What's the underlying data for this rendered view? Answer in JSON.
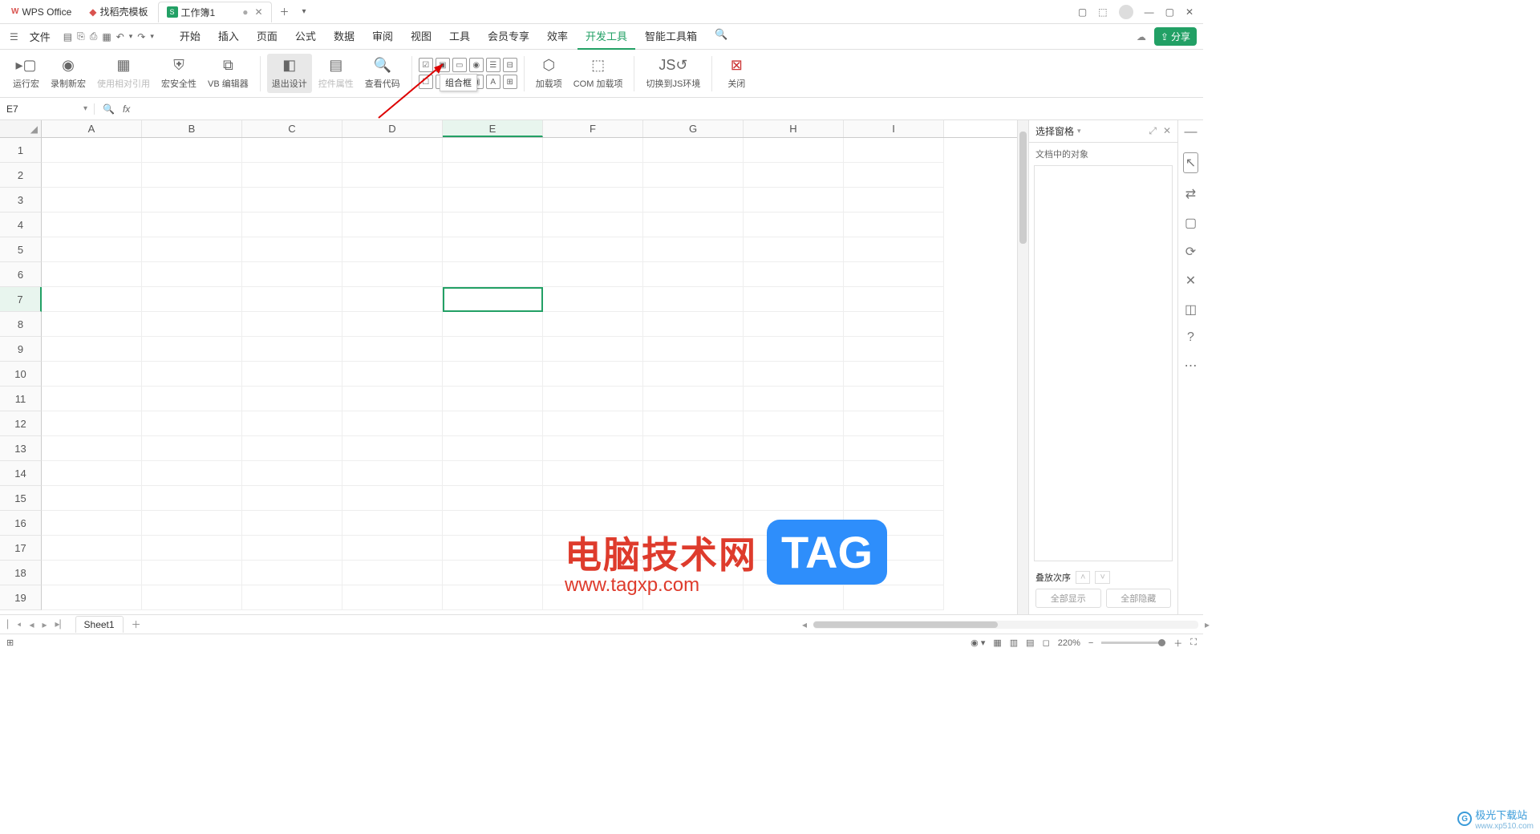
{
  "titlebar": {
    "tabs": [
      {
        "icon": "wps",
        "label": "WPS Office"
      },
      {
        "icon": "ds",
        "label": "找稻壳模板"
      },
      {
        "icon": "sheet",
        "label": "工作簿1",
        "active": true,
        "dirty": true
      }
    ]
  },
  "menu": {
    "file": "文件",
    "tabs": [
      "开始",
      "插入",
      "页面",
      "公式",
      "数据",
      "审阅",
      "视图",
      "工具",
      "会员专享",
      "效率",
      "开发工具",
      "智能工具箱"
    ],
    "active_index": 10,
    "share": "分享"
  },
  "ribbon": {
    "run_macro": "运行宏",
    "record_macro": "录制新宏",
    "use_relative": "使用相对引用",
    "macro_security": "宏安全性",
    "vb_editor": "VB 编辑器",
    "exit_design": "退出设计",
    "ctrl_props": "控件属性",
    "view_code": "查看代码",
    "addins": "加载项",
    "com_addins": "COM 加载项",
    "switch_js": "切换到JS环境",
    "close": "关闭",
    "tooltip": "组合框"
  },
  "formula": {
    "name_box": "E7",
    "fx": "fx"
  },
  "grid": {
    "columns": [
      "A",
      "B",
      "C",
      "D",
      "E",
      "F",
      "G",
      "H",
      "I"
    ],
    "rows": [
      "1",
      "2",
      "3",
      "4",
      "5",
      "6",
      "7",
      "8",
      "9",
      "10",
      "11",
      "12",
      "13",
      "14",
      "15",
      "16",
      "17",
      "18",
      "19"
    ],
    "active_col": "E",
    "active_row": "7"
  },
  "right_pane": {
    "title": "选择窗格",
    "subtitle": "文档中的对象",
    "stack_label": "叠放次序",
    "show_all": "全部显示",
    "hide_all": "全部隐藏"
  },
  "sheets": {
    "active": "Sheet1"
  },
  "status": {
    "zoom": "220%"
  },
  "watermark": {
    "text": "电脑技术网",
    "url": "www.tagxp.com",
    "tag": "TAG",
    "site": "极光下载站",
    "site_url": "www.xp510.com"
  }
}
